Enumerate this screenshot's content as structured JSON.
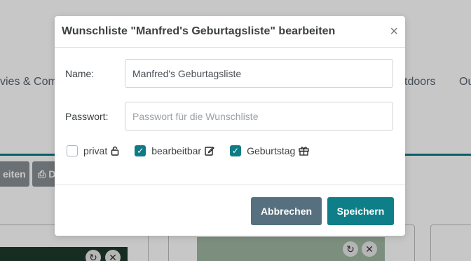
{
  "background": {
    "nav_left": "vies & Com",
    "nav_right": "tdoors",
    "nav_right2": "Ou",
    "btn1": "eiten",
    "btn2": "D"
  },
  "modal": {
    "title": "Wunschliste \"Manfred's Geburtagsliste\" bearbeiten",
    "close": "×",
    "name_label": "Name:",
    "name_value": "Manfred's Geburtagsliste",
    "password_label": "Passwort:",
    "password_placeholder": "Passwort für die Wunschliste",
    "checkboxes": [
      {
        "label": "privat",
        "checked": false,
        "icon": "lock-icon"
      },
      {
        "label": "bearbeitbar",
        "checked": true,
        "icon": "edit-icon"
      },
      {
        "label": "Geburtstag",
        "checked": true,
        "icon": "gift-icon"
      }
    ],
    "cancel_label": "Abbrechen",
    "save_label": "Speichern"
  },
  "colors": {
    "accent": "#0e7b86",
    "cancel": "#56707f"
  }
}
